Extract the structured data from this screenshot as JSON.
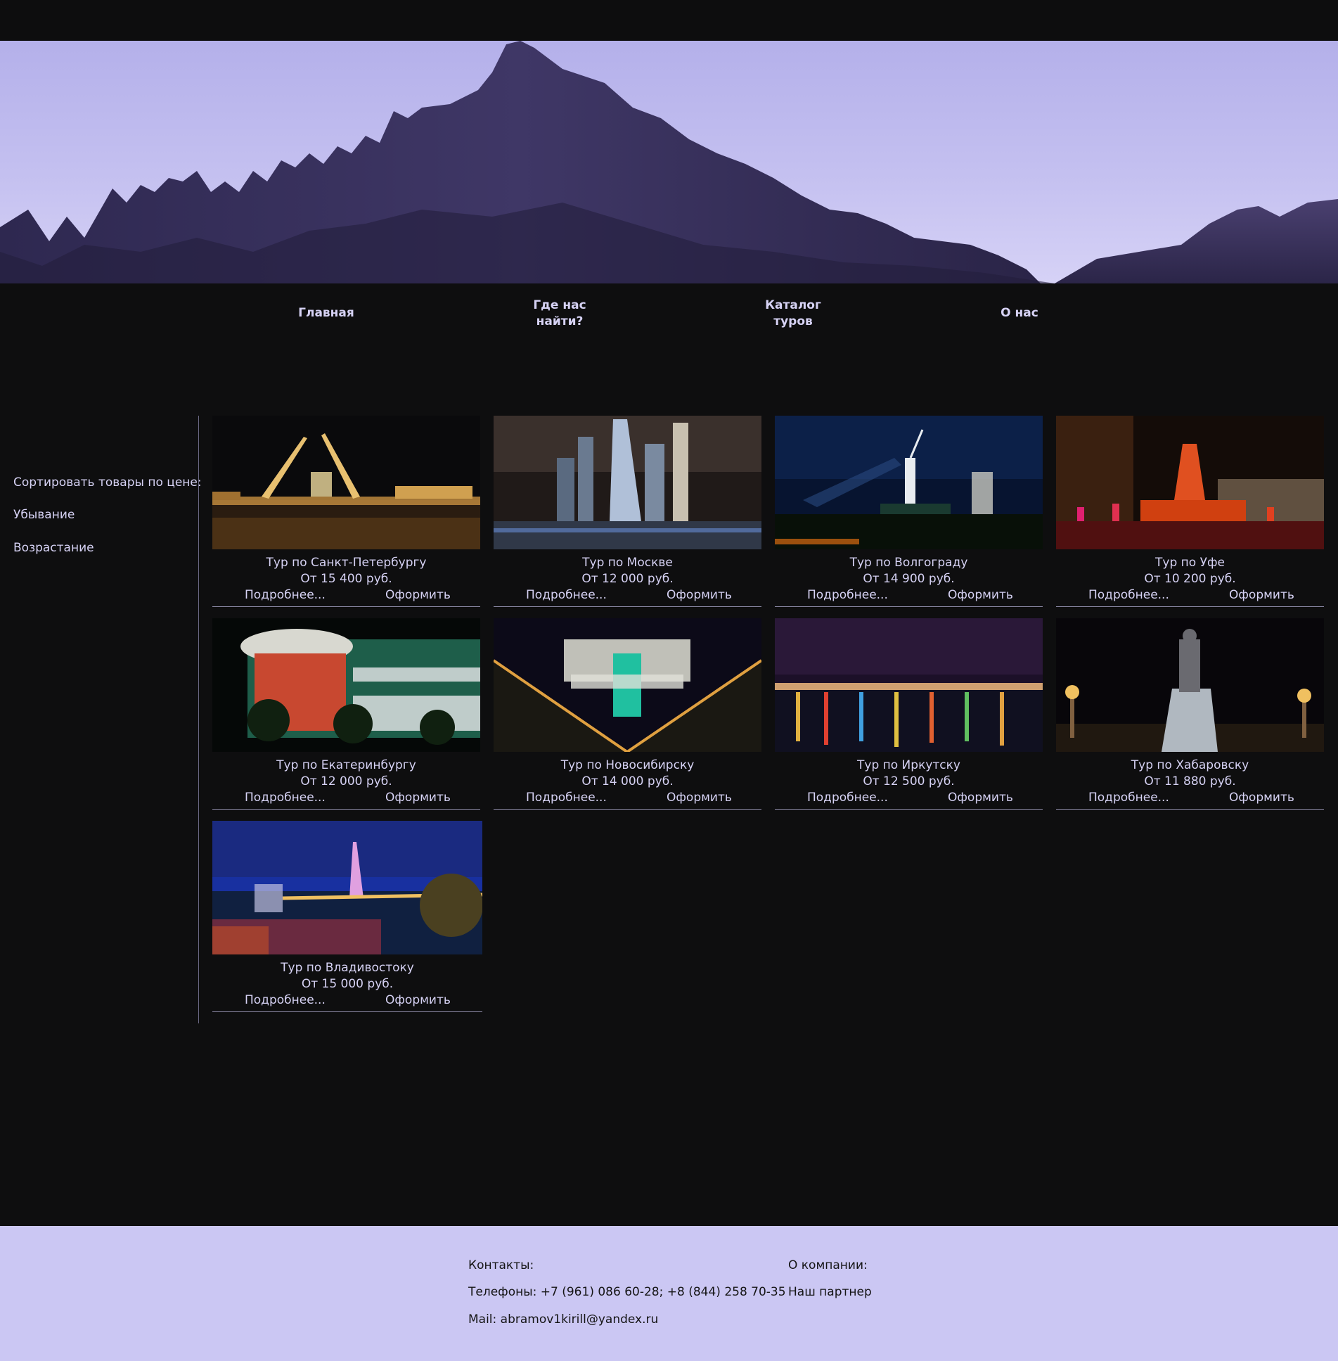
{
  "nav": {
    "home": "Главная",
    "where_line1": "Где нас",
    "where_line2": "найти?",
    "catalog_line1": "Каталог",
    "catalog_line2": "туров",
    "about": "О нас"
  },
  "sidebar": {
    "title": "Сортировать товары по цене:",
    "desc": "Убывание",
    "asc": "Возрастание"
  },
  "tours": [
    {
      "name": "Тур по Санкт-Петербургу",
      "price": "От 15 400 руб.",
      "more": "Подробнее...",
      "order": "Оформить"
    },
    {
      "name": "Тур по Москве",
      "price": "От 12 000 руб.",
      "more": "Подробнее...",
      "order": "Оформить"
    },
    {
      "name": "Тур по Волгограду",
      "price": "От 14 900 руб.",
      "more": "Подробнее...",
      "order": "Оформить"
    },
    {
      "name": "Тур по Уфе",
      "price": "От 10 200 руб.",
      "more": "Подробнее...",
      "order": "Оформить"
    },
    {
      "name": "Тур по Екатеринбургу",
      "price": "От 12 000 руб.",
      "more": "Подробнее...",
      "order": "Оформить"
    },
    {
      "name": "Тур по Новосибирску",
      "price": "От 14 000 руб.",
      "more": "Подробнее...",
      "order": "Оформить"
    },
    {
      "name": "Тур по Иркутску",
      "price": "От 12 500 руб.",
      "more": "Подробнее...",
      "order": "Оформить"
    },
    {
      "name": "Тур по Хабаровску",
      "price": "От 11 880 руб.",
      "more": "Подробнее...",
      "order": "Оформить"
    },
    {
      "name": "Тур по Владивостоку",
      "price": "От 15 000 руб.",
      "more": "Подробнее...",
      "order": "Оформить"
    }
  ],
  "footer": {
    "contacts_title": "Контакты:",
    "phones": "Телефоны: +7 (961) 086 60-28; +8 (844) 258 70-35",
    "mail": "Mail: abramov1kirill@yandex.ru",
    "company_title": "О компании:",
    "partner": "Наш партнер"
  },
  "colors": {
    "background": "#0e0e0f",
    "text": "#d6d2f4",
    "footer": "#cbc7f3"
  }
}
